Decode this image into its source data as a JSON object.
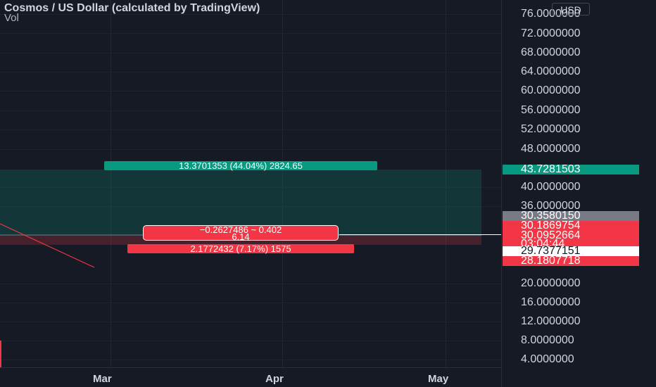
{
  "header": {
    "title": "Cosmos / US Dollar (calculated by TradingView)",
    "volume_label": "Vol",
    "currency": "USD"
  },
  "price_axis": {
    "ticks": [
      "76.0000000",
      "72.0000000",
      "68.0000000",
      "64.0000000",
      "60.0000000",
      "56.0000000",
      "52.0000000",
      "48.0000000",
      "40.0000000",
      "36.0000000",
      "20.0000000",
      "16.0000000",
      "12.0000000",
      "8.0000000",
      "4.0000000"
    ]
  },
  "price_tags": {
    "target": "43.7281503",
    "gray": "30.3580150",
    "red_1": "30.1869754",
    "red_2": "30.0952664",
    "countdown": "03:04:44",
    "last": "29.7377151",
    "stop": "28.1807718"
  },
  "position_tool": {
    "profit_label": "13.3701353 (44.04%) 2824.65",
    "loss_label": "2.1772432 (7.17%) 1575",
    "center_line1": "−0.2627486 ~ 0.402",
    "center_line2": "6.14"
  },
  "time_axis": {
    "labels": [
      "Mar",
      "Apr",
      "May"
    ]
  },
  "colors": {
    "background": "#161a25",
    "profit": "#089981",
    "loss": "#f23645",
    "text": "#d1d4dc"
  }
}
